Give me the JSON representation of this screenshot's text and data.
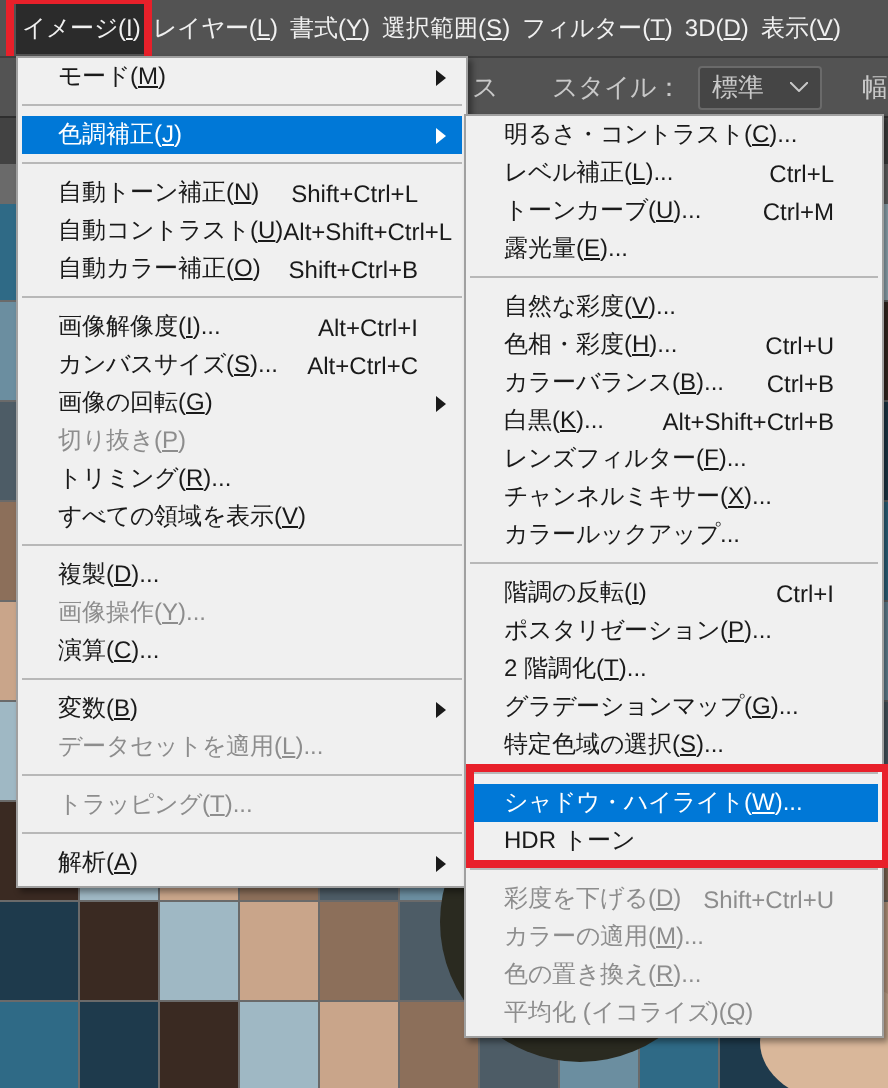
{
  "menubar": [
    {
      "label": "イメージ(I)",
      "selected": true,
      "annotated": true
    },
    {
      "label": "レイヤー(L)",
      "selected": false,
      "annotated": false
    },
    {
      "label": "書式(Y)",
      "selected": false,
      "annotated": false
    },
    {
      "label": "選択範囲(S)",
      "selected": false,
      "annotated": false
    },
    {
      "label": "フィルター(T)",
      "selected": false,
      "annotated": false
    },
    {
      "label": "3D(D)",
      "selected": false,
      "annotated": false
    },
    {
      "label": "表示(V)",
      "selected": false,
      "annotated": false
    }
  ],
  "options_bar": {
    "partial_label": "ス",
    "style_label": "スタイル：",
    "style_value": "標準",
    "width_label": "幅"
  },
  "menu": [
    {
      "kind": "item",
      "label": "モード(M)",
      "disabled": false,
      "selected": false,
      "has_submenu": true
    },
    {
      "kind": "separator"
    },
    {
      "kind": "item",
      "label": "色調補正(J)",
      "disabled": false,
      "selected": true,
      "has_submenu": true
    },
    {
      "kind": "separator"
    },
    {
      "kind": "item",
      "label": "自動トーン補正(N)",
      "shortcut": "Shift+Ctrl+L",
      "disabled": false,
      "selected": false
    },
    {
      "kind": "item",
      "label": "自動コントラスト(U)",
      "shortcut": "Alt+Shift+Ctrl+L",
      "disabled": false,
      "selected": false
    },
    {
      "kind": "item",
      "label": "自動カラー補正(O)",
      "shortcut": "Shift+Ctrl+B",
      "disabled": false,
      "selected": false
    },
    {
      "kind": "separator"
    },
    {
      "kind": "item",
      "label": "画像解像度(I)...",
      "shortcut": "Alt+Ctrl+I",
      "disabled": false,
      "selected": false
    },
    {
      "kind": "item",
      "label": "カンバスサイズ(S)...",
      "shortcut": "Alt+Ctrl+C",
      "disabled": false,
      "selected": false
    },
    {
      "kind": "item",
      "label": "画像の回転(G)",
      "disabled": false,
      "selected": false,
      "has_submenu": true
    },
    {
      "kind": "item",
      "label": "切り抜き(P)",
      "disabled": true,
      "selected": false
    },
    {
      "kind": "item",
      "label": "トリミング(R)...",
      "disabled": false,
      "selected": false
    },
    {
      "kind": "item",
      "label": "すべての領域を表示(V)",
      "disabled": false,
      "selected": false
    },
    {
      "kind": "separator"
    },
    {
      "kind": "item",
      "label": "複製(D)...",
      "disabled": false,
      "selected": false
    },
    {
      "kind": "item",
      "label": "画像操作(Y)...",
      "disabled": true,
      "selected": false
    },
    {
      "kind": "item",
      "label": "演算(C)...",
      "disabled": false,
      "selected": false
    },
    {
      "kind": "separator"
    },
    {
      "kind": "item",
      "label": "変数(B)",
      "disabled": false,
      "selected": false,
      "has_submenu": true
    },
    {
      "kind": "item",
      "label": "データセットを適用(L)...",
      "disabled": true,
      "selected": false
    },
    {
      "kind": "separator"
    },
    {
      "kind": "item",
      "label": "トラッピング(T)...",
      "disabled": true,
      "selected": false
    },
    {
      "kind": "separator"
    },
    {
      "kind": "item",
      "label": "解析(A)",
      "disabled": false,
      "selected": false,
      "has_submenu": true
    }
  ],
  "submenu": [
    {
      "kind": "item",
      "label": "明るさ・コントラスト(C)...",
      "disabled": false,
      "selected": false
    },
    {
      "kind": "item",
      "label": "レベル補正(L)...",
      "shortcut": "Ctrl+L",
      "disabled": false,
      "selected": false
    },
    {
      "kind": "item",
      "label": "トーンカーブ(U)...",
      "shortcut": "Ctrl+M",
      "disabled": false,
      "selected": false
    },
    {
      "kind": "item",
      "label": "露光量(E)...",
      "disabled": false,
      "selected": false
    },
    {
      "kind": "separator"
    },
    {
      "kind": "item",
      "label": "自然な彩度(V)...",
      "disabled": false,
      "selected": false
    },
    {
      "kind": "item",
      "label": "色相・彩度(H)...",
      "shortcut": "Ctrl+U",
      "disabled": false,
      "selected": false
    },
    {
      "kind": "item",
      "label": "カラーバランス(B)...",
      "shortcut": "Ctrl+B",
      "disabled": false,
      "selected": false
    },
    {
      "kind": "item",
      "label": "白黒(K)...",
      "shortcut": "Alt+Shift+Ctrl+B",
      "disabled": false,
      "selected": false
    },
    {
      "kind": "item",
      "label": "レンズフィルター(F)...",
      "disabled": false,
      "selected": false
    },
    {
      "kind": "item",
      "label": "チャンネルミキサー(X)...",
      "disabled": false,
      "selected": false
    },
    {
      "kind": "item",
      "label": "カラールックアップ...",
      "disabled": false,
      "selected": false
    },
    {
      "kind": "separator"
    },
    {
      "kind": "item",
      "label": "階調の反転(I)",
      "shortcut": "Ctrl+I",
      "disabled": false,
      "selected": false
    },
    {
      "kind": "item",
      "label": "ポスタリゼーション(P)...",
      "disabled": false,
      "selected": false
    },
    {
      "kind": "item",
      "label": "2 階調化(T)...",
      "disabled": false,
      "selected": false
    },
    {
      "kind": "item",
      "label": "グラデーションマップ(G)...",
      "disabled": false,
      "selected": false
    },
    {
      "kind": "item",
      "label": "特定色域の選択(S)...",
      "disabled": false,
      "selected": false
    },
    {
      "kind": "separator"
    },
    {
      "kind": "item",
      "label": "シャドウ・ハイライト(W)...",
      "disabled": false,
      "selected": true,
      "annotated": true
    },
    {
      "kind": "item",
      "label": "HDR トーン",
      "disabled": false,
      "selected": false
    },
    {
      "kind": "separator"
    },
    {
      "kind": "item",
      "label": "彩度を下げる(D)",
      "shortcut": "Shift+Ctrl+U",
      "disabled": true,
      "selected": false
    },
    {
      "kind": "item",
      "label": "カラーの適用(M)...",
      "disabled": true,
      "selected": false
    },
    {
      "kind": "item",
      "label": "色の置き換え(R)...",
      "disabled": true,
      "selected": false
    },
    {
      "kind": "item",
      "label": "平均化 (イコライズ)(Q)",
      "disabled": true,
      "selected": false
    }
  ]
}
